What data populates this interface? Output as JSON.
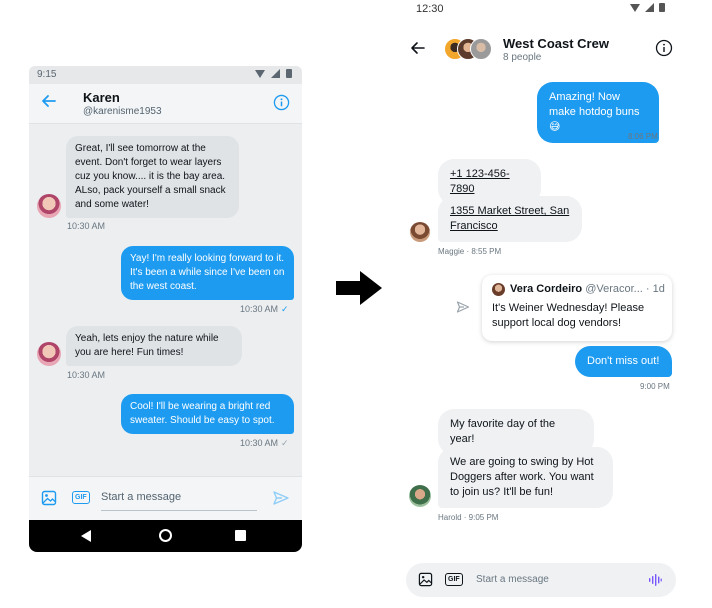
{
  "left_phone": {
    "status": {
      "time": "9:15"
    },
    "header": {
      "name": "Karen",
      "handle": "@karenisme1953"
    },
    "messages": [
      {
        "from": "them",
        "text": "Great, I'll see tomorrow at the event. Don't forget to wear layers cuz you know.... it is the bay area. ALso, pack yourself a small snack and some water!",
        "time": "10:30 AM"
      },
      {
        "from": "me",
        "text": "Yay! I'm really looking forward to it. It's been a while since I've been on the west coast.",
        "time": "10:30 AM"
      },
      {
        "from": "them",
        "text": "Yeah, lets enjoy the nature while you are here! Fun times!",
        "time": "10:30 AM"
      },
      {
        "from": "me",
        "text": "Cool! I'll be wearing a bright red sweater. Should be easy to spot.",
        "time": "10:30 AM"
      }
    ],
    "compose": {
      "gif_label": "GIF",
      "placeholder": "Start a message"
    }
  },
  "right_phone": {
    "status": {
      "time": "12:30"
    },
    "header": {
      "title": "West Coast Crew",
      "subtitle": "8 people"
    },
    "messages": {
      "m1": {
        "text": "Amazing! Now make hotdog buns 😅",
        "time": "8:06 PM"
      },
      "m2": {
        "text": "+1 123-456-7890"
      },
      "m3": {
        "text": "1355 Market Street, San Francisco",
        "meta": "Maggie · 8:55 PM"
      },
      "quote": {
        "name": "Vera Cordeiro",
        "handle": "@Veracor... · 1d",
        "text": "It's Weiner Wednesday! Please support local dog vendors!"
      },
      "m4": {
        "text": "Don't miss out!",
        "time": "9:00 PM"
      },
      "m5": {
        "text": "My favorite day of the year!"
      },
      "m6": {
        "text": "We are going to swing by Hot Doggers after work. You want to join us? It'll be fun!",
        "meta": "Harold · 9:05 PM"
      }
    },
    "compose": {
      "gif_label": "GIF",
      "placeholder": "Start a message"
    }
  },
  "colors": {
    "accent": "#1d9bf0",
    "incoming_bubble": "#e0e3e6",
    "nav_bar": "#000000"
  }
}
